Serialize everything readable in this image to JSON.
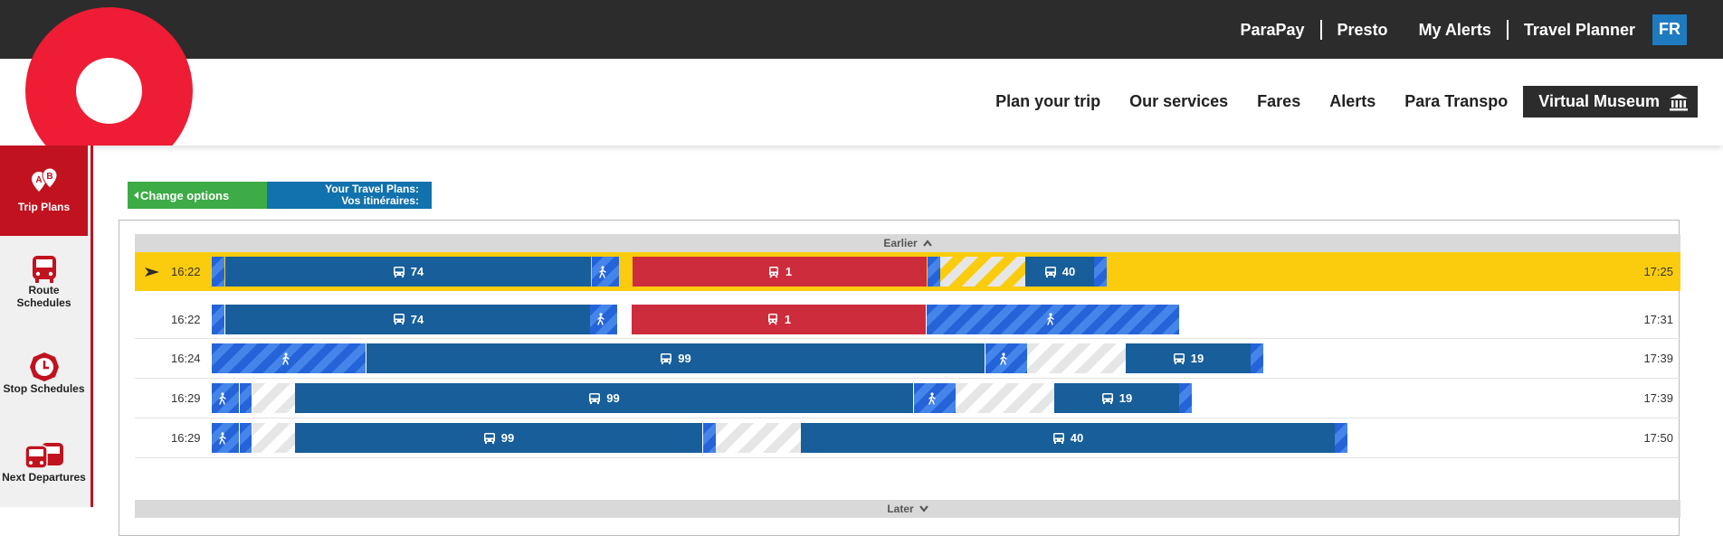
{
  "top_nav": {
    "links": [
      "ParaPay",
      "Presto",
      "My Alerts",
      "Travel Planner"
    ],
    "lang": "FR"
  },
  "main_nav": {
    "links": [
      "Plan your trip",
      "Our services",
      "Fares",
      "Alerts",
      "Para Transpo"
    ],
    "museum": "Virtual Museum"
  },
  "sidebar": {
    "items": [
      {
        "label": "Trip Plans",
        "icon": "ab-pins-icon",
        "active": true
      },
      {
        "label": "Route Schedules",
        "icon": "bus-icon",
        "active": false
      },
      {
        "label": "Stop Schedules",
        "icon": "clock-icon",
        "active": false
      },
      {
        "label": "Next Departures",
        "icon": "buses-icon",
        "active": false
      }
    ]
  },
  "options": {
    "change": "Change options",
    "title_en": "Your Travel Plans:",
    "title_fr": "Vos itinéraires:"
  },
  "pager": {
    "earlier": "Earlier",
    "later": "Later"
  },
  "trips": [
    {
      "depart": "16:22",
      "arrive": "17:25",
      "selected": true,
      "legs": [
        {
          "type": "walk",
          "label": ""
        },
        {
          "type": "bus",
          "label": "74"
        },
        {
          "type": "walk",
          "label": ""
        },
        {
          "type": "train",
          "label": "1"
        },
        {
          "type": "walk",
          "label": ""
        },
        {
          "type": "bus",
          "label": "40"
        },
        {
          "type": "walk",
          "label": ""
        }
      ]
    },
    {
      "depart": "16:22",
      "arrive": "17:31",
      "selected": false,
      "legs": [
        {
          "type": "walk",
          "label": ""
        },
        {
          "type": "bus",
          "label": "74"
        },
        {
          "type": "walk",
          "label": ""
        },
        {
          "type": "train",
          "label": "1"
        },
        {
          "type": "walk",
          "label": ""
        }
      ]
    },
    {
      "depart": "16:24",
      "arrive": "17:39",
      "selected": false,
      "legs": [
        {
          "type": "walk",
          "label": ""
        },
        {
          "type": "bus",
          "label": "99"
        },
        {
          "type": "walk",
          "label": ""
        },
        {
          "type": "bus",
          "label": "19"
        },
        {
          "type": "walk",
          "label": ""
        }
      ]
    },
    {
      "depart": "16:29",
      "arrive": "17:39",
      "selected": false,
      "legs": [
        {
          "type": "walk",
          "label": ""
        },
        {
          "type": "walk",
          "label": ""
        },
        {
          "type": "bus",
          "label": "99"
        },
        {
          "type": "walk",
          "label": ""
        },
        {
          "type": "bus",
          "label": "19"
        },
        {
          "type": "walk",
          "label": ""
        }
      ]
    },
    {
      "depart": "16:29",
      "arrive": "17:50",
      "selected": false,
      "legs": [
        {
          "type": "walk",
          "label": ""
        },
        {
          "type": "walk",
          "label": ""
        },
        {
          "type": "bus",
          "label": "99"
        },
        {
          "type": "walk",
          "label": ""
        },
        {
          "type": "bus",
          "label": "40"
        },
        {
          "type": "walk",
          "label": ""
        }
      ]
    }
  ],
  "colors": {
    "brand_red": "#ee1c34",
    "selected_row": "#fbcc0d",
    "bus": "#175e9a",
    "train": "#cd2c3c",
    "walk": "#2563d8",
    "change_options": "#3dab46"
  }
}
